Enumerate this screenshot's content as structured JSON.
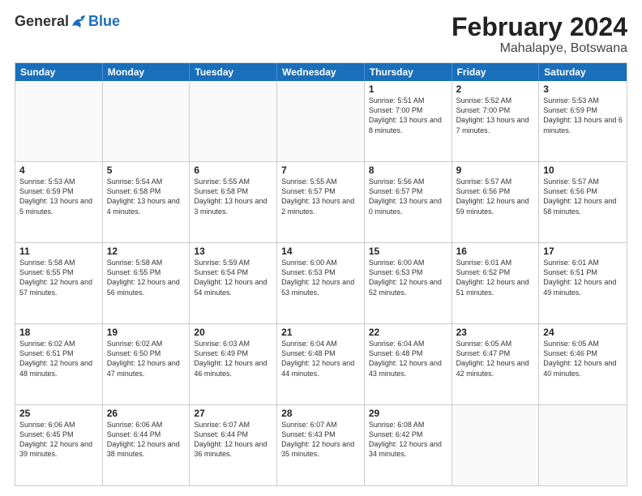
{
  "logo": {
    "general": "General",
    "blue": "Blue"
  },
  "title": "February 2024",
  "subtitle": "Mahalapye, Botswana",
  "days": [
    "Sunday",
    "Monday",
    "Tuesday",
    "Wednesday",
    "Thursday",
    "Friday",
    "Saturday"
  ],
  "weeks": [
    [
      {
        "day": "",
        "info": ""
      },
      {
        "day": "",
        "info": ""
      },
      {
        "day": "",
        "info": ""
      },
      {
        "day": "",
        "info": ""
      },
      {
        "day": "1",
        "info": "Sunrise: 5:51 AM\nSunset: 7:00 PM\nDaylight: 13 hours\nand 8 minutes."
      },
      {
        "day": "2",
        "info": "Sunrise: 5:52 AM\nSunset: 7:00 PM\nDaylight: 13 hours\nand 7 minutes."
      },
      {
        "day": "3",
        "info": "Sunrise: 5:53 AM\nSunset: 6:59 PM\nDaylight: 13 hours\nand 6 minutes."
      }
    ],
    [
      {
        "day": "4",
        "info": "Sunrise: 5:53 AM\nSunset: 6:59 PM\nDaylight: 13 hours\nand 5 minutes."
      },
      {
        "day": "5",
        "info": "Sunrise: 5:54 AM\nSunset: 6:58 PM\nDaylight: 13 hours\nand 4 minutes."
      },
      {
        "day": "6",
        "info": "Sunrise: 5:55 AM\nSunset: 6:58 PM\nDaylight: 13 hours\nand 3 minutes."
      },
      {
        "day": "7",
        "info": "Sunrise: 5:55 AM\nSunset: 6:57 PM\nDaylight: 13 hours\nand 2 minutes."
      },
      {
        "day": "8",
        "info": "Sunrise: 5:56 AM\nSunset: 6:57 PM\nDaylight: 13 hours\nand 0 minutes."
      },
      {
        "day": "9",
        "info": "Sunrise: 5:57 AM\nSunset: 6:56 PM\nDaylight: 12 hours\nand 59 minutes."
      },
      {
        "day": "10",
        "info": "Sunrise: 5:57 AM\nSunset: 6:56 PM\nDaylight: 12 hours\nand 58 minutes."
      }
    ],
    [
      {
        "day": "11",
        "info": "Sunrise: 5:58 AM\nSunset: 6:55 PM\nDaylight: 12 hours\nand 57 minutes."
      },
      {
        "day": "12",
        "info": "Sunrise: 5:58 AM\nSunset: 6:55 PM\nDaylight: 12 hours\nand 56 minutes."
      },
      {
        "day": "13",
        "info": "Sunrise: 5:59 AM\nSunset: 6:54 PM\nDaylight: 12 hours\nand 54 minutes."
      },
      {
        "day": "14",
        "info": "Sunrise: 6:00 AM\nSunset: 6:53 PM\nDaylight: 12 hours\nand 53 minutes."
      },
      {
        "day": "15",
        "info": "Sunrise: 6:00 AM\nSunset: 6:53 PM\nDaylight: 12 hours\nand 52 minutes."
      },
      {
        "day": "16",
        "info": "Sunrise: 6:01 AM\nSunset: 6:52 PM\nDaylight: 12 hours\nand 51 minutes."
      },
      {
        "day": "17",
        "info": "Sunrise: 6:01 AM\nSunset: 6:51 PM\nDaylight: 12 hours\nand 49 minutes."
      }
    ],
    [
      {
        "day": "18",
        "info": "Sunrise: 6:02 AM\nSunset: 6:51 PM\nDaylight: 12 hours\nand 48 minutes."
      },
      {
        "day": "19",
        "info": "Sunrise: 6:02 AM\nSunset: 6:50 PM\nDaylight: 12 hours\nand 47 minutes."
      },
      {
        "day": "20",
        "info": "Sunrise: 6:03 AM\nSunset: 6:49 PM\nDaylight: 12 hours\nand 46 minutes."
      },
      {
        "day": "21",
        "info": "Sunrise: 6:04 AM\nSunset: 6:48 PM\nDaylight: 12 hours\nand 44 minutes."
      },
      {
        "day": "22",
        "info": "Sunrise: 6:04 AM\nSunset: 6:48 PM\nDaylight: 12 hours\nand 43 minutes."
      },
      {
        "day": "23",
        "info": "Sunrise: 6:05 AM\nSunset: 6:47 PM\nDaylight: 12 hours\nand 42 minutes."
      },
      {
        "day": "24",
        "info": "Sunrise: 6:05 AM\nSunset: 6:46 PM\nDaylight: 12 hours\nand 40 minutes."
      }
    ],
    [
      {
        "day": "25",
        "info": "Sunrise: 6:06 AM\nSunset: 6:45 PM\nDaylight: 12 hours\nand 39 minutes."
      },
      {
        "day": "26",
        "info": "Sunrise: 6:06 AM\nSunset: 6:44 PM\nDaylight: 12 hours\nand 38 minutes."
      },
      {
        "day": "27",
        "info": "Sunrise: 6:07 AM\nSunset: 6:44 PM\nDaylight: 12 hours\nand 36 minutes."
      },
      {
        "day": "28",
        "info": "Sunrise: 6:07 AM\nSunset: 6:43 PM\nDaylight: 12 hours\nand 35 minutes."
      },
      {
        "day": "29",
        "info": "Sunrise: 6:08 AM\nSunset: 6:42 PM\nDaylight: 12 hours\nand 34 minutes."
      },
      {
        "day": "",
        "info": ""
      },
      {
        "day": "",
        "info": ""
      }
    ]
  ]
}
